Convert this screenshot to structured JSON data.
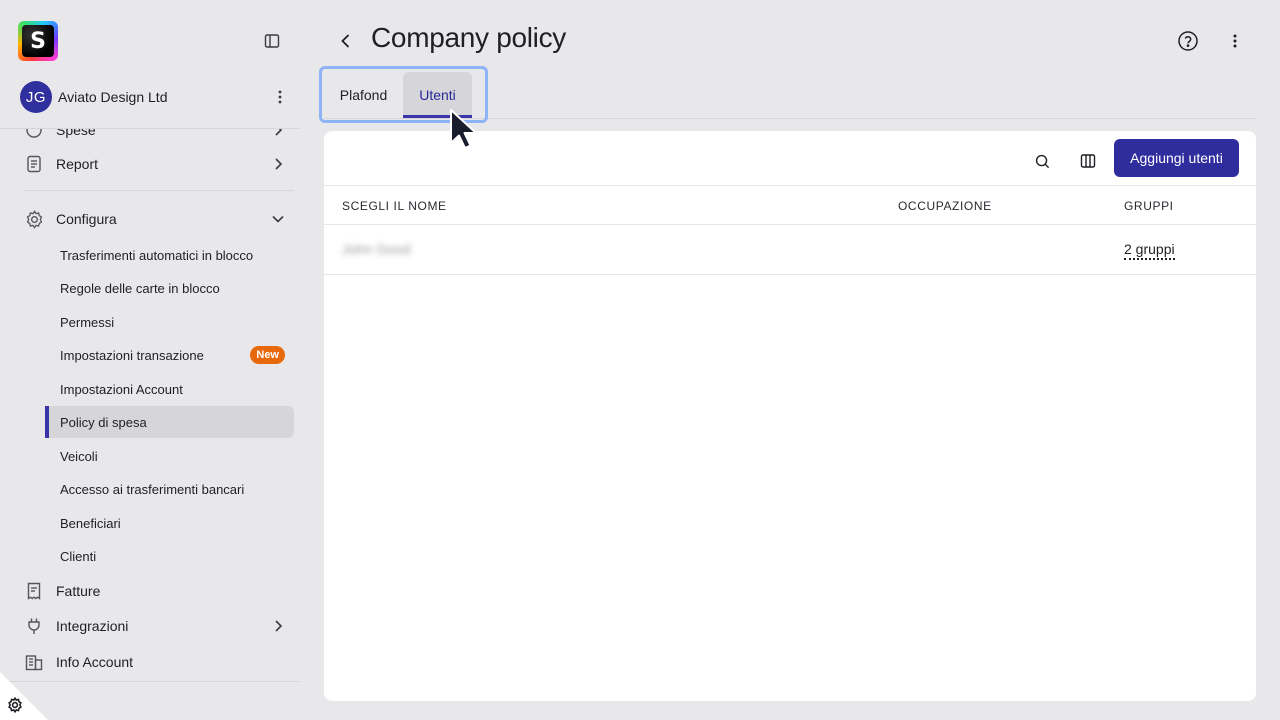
{
  "app": {
    "logo_letter": "S",
    "page_title": "Company policy"
  },
  "account": {
    "avatar_initials": "JG",
    "company_name": "Aviato Design Ltd"
  },
  "sidebar": {
    "partial_item": "Spese",
    "items": [
      {
        "label": "Report",
        "icon": "report-icon"
      },
      {
        "label": "Configura",
        "icon": "gear-icon"
      },
      {
        "label": "Fatture",
        "icon": "invoice-icon"
      },
      {
        "label": "Integrazioni",
        "icon": "plug-icon"
      },
      {
        "label": "Info Account",
        "icon": "building-icon"
      }
    ],
    "configura_sub": [
      {
        "label": "Trasferimenti automatici in blocco"
      },
      {
        "label": "Regole delle carte in blocco"
      },
      {
        "label": "Permessi"
      },
      {
        "label": "Impostazioni transazione",
        "badge": "New"
      },
      {
        "label": "Impostazioni Account"
      },
      {
        "label": "Policy di spesa"
      },
      {
        "label": "Veicoli"
      },
      {
        "label": "Accesso ai trasferimenti bancari"
      },
      {
        "label": "Beneficiari"
      },
      {
        "label": "Clienti"
      }
    ]
  },
  "tabs": [
    {
      "label": "Plafond"
    },
    {
      "label": "Utenti"
    }
  ],
  "toolbar": {
    "add_users_label": "Aggiungi utenti"
  },
  "table": {
    "columns": [
      "SCEGLI IL NOME",
      "OCCUPAZIONE",
      "GRUPPI"
    ],
    "rows": [
      {
        "name": "John Good",
        "occupation": "",
        "groups": "2 gruppi"
      }
    ]
  },
  "colors": {
    "accent": "#2f2c9e",
    "badge_new": "#e8690b",
    "focus_ring": "#8fb3f7"
  }
}
